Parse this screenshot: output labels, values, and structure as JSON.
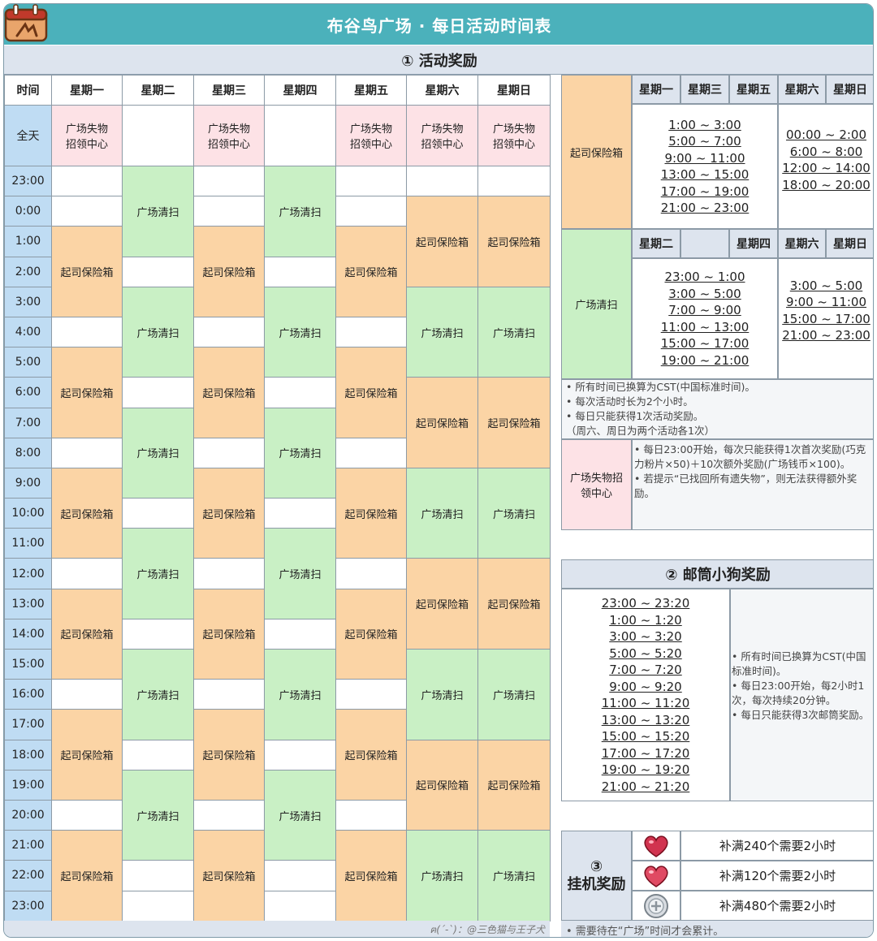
{
  "title": "布谷鸟广场 · 每日活动时间表",
  "section1": {
    "title": "① 活动奖励"
  },
  "schedule": {
    "time_header": "时间",
    "days": [
      "星期一",
      "星期二",
      "星期三",
      "星期四",
      "星期五",
      "星期六",
      "星期日"
    ],
    "allday_label": "全天",
    "lost_found": "广场失物招领中心",
    "hours": [
      "23:00",
      "0:00",
      "1:00",
      "2:00",
      "3:00",
      "4:00",
      "5:00",
      "6:00",
      "7:00",
      "8:00",
      "9:00",
      "10:00",
      "11:00",
      "12:00",
      "13:00",
      "14:00",
      "15:00",
      "16:00",
      "17:00",
      "18:00",
      "19:00",
      "20:00",
      "21:00",
      "22:00",
      "23:00"
    ],
    "labels": {
      "cheese": "起司保险箱",
      "sweep": "广场清扫"
    }
  },
  "right_panel": {
    "cheese": {
      "label": "起司保险箱",
      "days_a": [
        "星期一",
        "星期三",
        "星期五"
      ],
      "days_b": [
        "星期六",
        "星期日"
      ],
      "times_a": [
        "1:00 ~ 3:00",
        "5:00 ~ 7:00",
        "9:00 ~ 11:00",
        "13:00 ~ 15:00",
        "17:00 ~ 19:00",
        "21:00 ~ 23:00"
      ],
      "times_b": [
        "00:00 ~ 2:00",
        "6:00 ~ 8:00",
        "12:00 ~ 14:00",
        "18:00 ~ 20:00"
      ]
    },
    "sweep": {
      "label": "广场清扫",
      "days_a": [
        "星期二",
        "",
        "星期四"
      ],
      "days_b": [
        "星期六",
        "星期日"
      ],
      "times_a": [
        "23:00 ~ 1:00",
        "3:00 ~ 5:00",
        "7:00 ~ 9:00",
        "11:00 ~ 13:00",
        "15:00 ~ 17:00",
        "19:00 ~ 21:00"
      ],
      "times_b": [
        "3:00 ~ 5:00",
        "9:00 ~ 11:00",
        "15:00 ~ 17:00",
        "21:00 ~ 23:00"
      ]
    },
    "notes": [
      "• 所有时间已换算为CST(中国标准时间)。",
      "• 每次活动时长为2个小时。",
      "• 每日只能获得1次活动奖励。",
      "（周六、周日为两个活动各1次）"
    ],
    "lost_found": {
      "label": "广场失物招领中心",
      "notes": [
        "• 每日23:00开始，每次只能获得1次首次奖励(巧克力粉片×50)＋10次额外奖励(广场钱币×100)。",
        "• 若提示“已找回所有遗失物”，则无法获得额外奖励。"
      ]
    }
  },
  "section2": {
    "title": "② 邮筒小狗奖励",
    "times": [
      "23:00 ~ 23:20",
      "1:00 ~ 1:20",
      "3:00 ~ 3:20",
      "5:00 ~ 5:20",
      "7:00 ~ 7:20",
      "9:00 ~ 9:20",
      "11:00 ~ 11:20",
      "13:00 ~ 13:20",
      "15:00 ~ 15:20",
      "17:00 ~ 17:20",
      "19:00 ~ 19:20",
      "21:00 ~ 21:20"
    ],
    "notes": [
      "• 所有时间已换算为CST(中国标准时间)。",
      "• 每日23:00开始，每2小时1次，每次持续20分钟。",
      "• 每日只能获得3次邮筒奖励。"
    ]
  },
  "section3": {
    "title_num": "③",
    "title": "挂机奖励",
    "rows": [
      {
        "icon": "heart-jelly-icon",
        "text": "补满240个需要2小时"
      },
      {
        "icon": "heart-jelly-icon",
        "text": "补满120个需要2小时"
      },
      {
        "icon": "coin-icon",
        "text": "补满480个需要2小时"
      }
    ],
    "footnote": "• 需要待在“广场”时间才会累计。"
  },
  "credit": "ฅ(´-`)：@三色猫与王子犬",
  "colors": {
    "title_bg": "#4bb1bb",
    "cheese": "#fbd4a5",
    "sweep": "#c9f0c5",
    "lost_found": "#fde2e6",
    "time_col": "#bfdcf3",
    "header_bg": "#dde4ee"
  }
}
